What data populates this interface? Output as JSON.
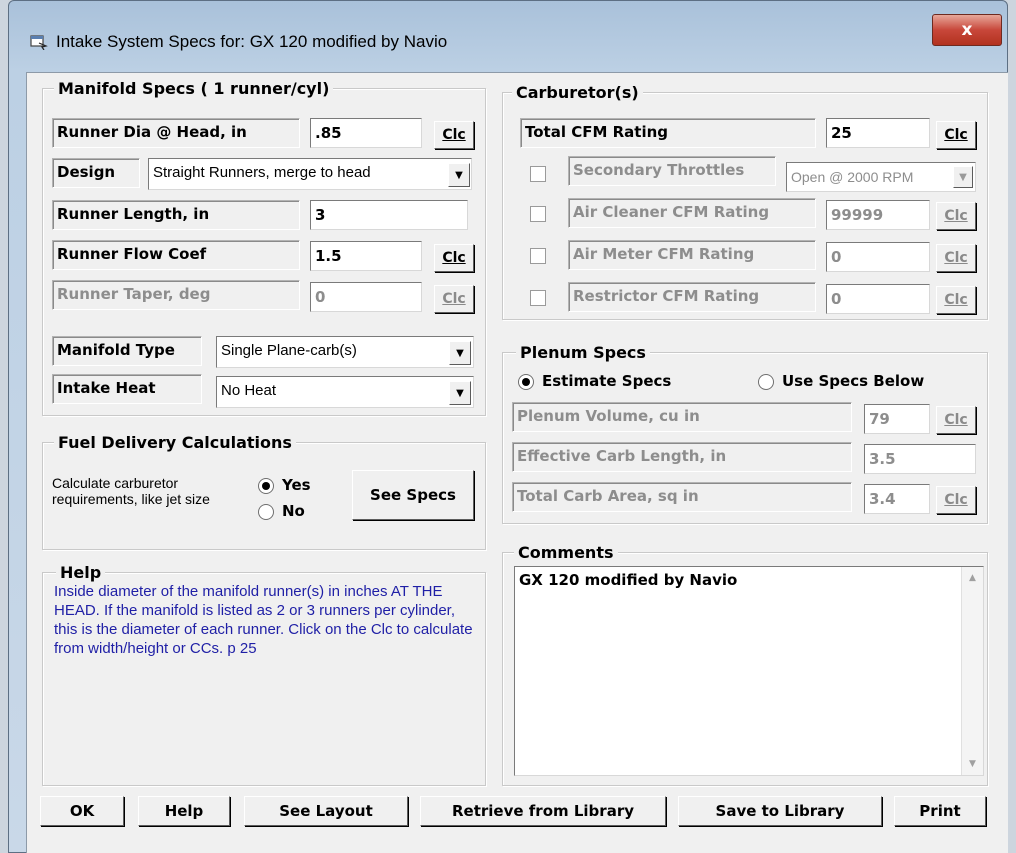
{
  "window": {
    "title": "Intake System Specs for: GX 120 modified by Navio",
    "close_label": "x"
  },
  "manifold": {
    "legend": "Manifold Specs ( 1 runner/cyl)",
    "runner_dia_label": "Runner Dia @ Head, in",
    "runner_dia_value": ".85",
    "design_label": "Design",
    "design_value": "Straight Runners, merge to head",
    "runner_length_label": "Runner Length, in",
    "runner_length_value": "3",
    "runner_flow_label": "Runner Flow Coef",
    "runner_flow_value": "1.5",
    "runner_taper_label": "Runner Taper, deg",
    "runner_taper_value": "0",
    "manifold_type_label": "Manifold Type",
    "manifold_type_value": "Single Plane-carb(s)",
    "intake_heat_label": "Intake Heat",
    "intake_heat_value": "No Heat",
    "clc_label": "Clc"
  },
  "carburetor": {
    "legend": "Carburetor(s)",
    "total_cfm_label": "Total CFM Rating",
    "total_cfm_value": "25",
    "secondary_label": "Secondary Throttles",
    "secondary_value": "Open @ 2000 RPM",
    "air_cleaner_label": "Air Cleaner CFM Rating",
    "air_cleaner_value": "99999",
    "air_meter_label": "Air Meter CFM Rating",
    "air_meter_value": "0",
    "restrictor_label": "Restrictor CFM Rating",
    "restrictor_value": "0"
  },
  "plenum": {
    "legend": "Plenum Specs",
    "estimate_label": "Estimate Specs",
    "use_specs_label": "Use Specs Below",
    "volume_label": "Plenum Volume, cu in",
    "volume_value": "79",
    "carb_length_label": "Effective Carb Length, in",
    "carb_length_value": "3.5",
    "carb_area_label": "Total Carb Area, sq in",
    "carb_area_value": "3.4"
  },
  "fuel": {
    "legend": "Fuel Delivery Calculations",
    "description": "Calculate carburetor requirements, like jet size",
    "yes_label": "Yes",
    "no_label": "No",
    "see_specs_label": "See Specs"
  },
  "help": {
    "legend": "Help",
    "text": "Inside diameter of the manifold runner(s) in inches AT THE HEAD.  If the manifold is listed as 2 or 3 runners per cylinder, this is the diameter of each runner.  Click on the Clc to calculate from width/height or CCs.  p 25"
  },
  "comments": {
    "legend": "Comments",
    "text": "GX 120 modified by Navio"
  },
  "buttons": {
    "ok": "OK",
    "help": "Help",
    "see_layout": "See Layout",
    "retrieve": "Retrieve from Library",
    "save": "Save to Library",
    "print": "Print"
  },
  "colors": {
    "help_text": "#1f1fa6",
    "disabled_text": "#8d8d8d",
    "dialog_bg": "#f0f0f0"
  }
}
